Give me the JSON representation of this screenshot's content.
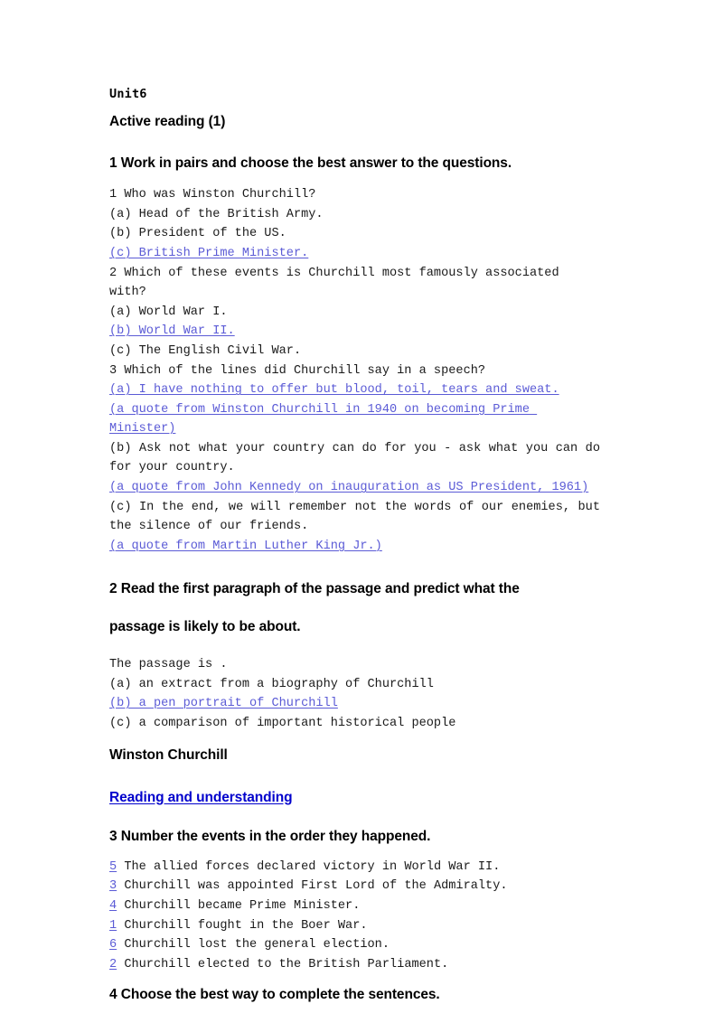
{
  "document": {
    "unit_label": "Unit6",
    "section_title": "Active reading (1)",
    "passage_title": "Winston Churchill",
    "reading_link": "Reading and understanding",
    "colors": {
      "answer_link": "#5B5BD6",
      "section_link": "#0000CC",
      "body_text": "#1a1a1a"
    }
  },
  "task1": {
    "heading": "1 Work in pairs and choose the best answer to the questions.",
    "questions": [
      {
        "prompt": "1 Who was Winston Churchill?",
        "options": [
          {
            "text": "(a) Head of the British Army.",
            "selected": false
          },
          {
            "text": "(b) President of the US.",
            "selected": false
          },
          {
            "text": "(c) British Prime Minister.",
            "selected": true
          }
        ]
      },
      {
        "prompt": "2 Which of these events is Churchill most famously associated with?",
        "options": [
          {
            "text": "(a) World War I.",
            "selected": false
          },
          {
            "text": "(b) World War II.",
            "selected": true
          },
          {
            "text": "(c) The English Civil War.",
            "selected": false
          }
        ]
      },
      {
        "prompt": "3 Which of the lines did Churchill say in a speech?",
        "options": [
          {
            "text": "(a) I have nothing to offer but blood, toil, tears and sweat.",
            "selected": true
          },
          {
            "text": "(a quote from Winston Churchill in 1940 on becoming Prime Minister)",
            "selected": true
          },
          {
            "text": "(b) Ask not what your country can do for you - ask what you can do for your country.",
            "selected": false
          },
          {
            "text": "(a quote from John Kennedy on inauguration as US President, 1961)",
            "selected": true
          },
          {
            "text": "(c) In the end, we will remember not the words of our enemies, but the silence of our friends.",
            "selected": false
          },
          {
            "text": "(a quote from Martin Luther King Jr.)",
            "selected": true
          }
        ]
      }
    ]
  },
  "task2": {
    "heading_line1": "2 Read the first paragraph of the passage and predict what the",
    "heading_line2": "passage is likely to be about.",
    "stem": "The passage is .",
    "options": [
      {
        "text": "(a) an extract from a biography of Churchill",
        "selected": false
      },
      {
        "text": "(b) a pen portrait of Churchill",
        "selected": true
      },
      {
        "text": "(c) a comparison of important historical people",
        "selected": false
      }
    ]
  },
  "task3": {
    "heading": "3 Number the events in the order they happened.",
    "events": [
      {
        "number": "5",
        "text": " The allied forces declared victory in World War II."
      },
      {
        "number": "3",
        "text": " Churchill was appointed First Lord of the Admiralty."
      },
      {
        "number": "4",
        "text": " Churchill became Prime Minister."
      },
      {
        "number": "1",
        "text": " Churchill fought in the Boer War."
      },
      {
        "number": "6",
        "text": " Churchill lost the general election."
      },
      {
        "number": "2",
        "text": " Churchill elected to the British Parliament."
      }
    ]
  },
  "task4": {
    "heading": "4 Choose the best way to complete the sentences."
  }
}
